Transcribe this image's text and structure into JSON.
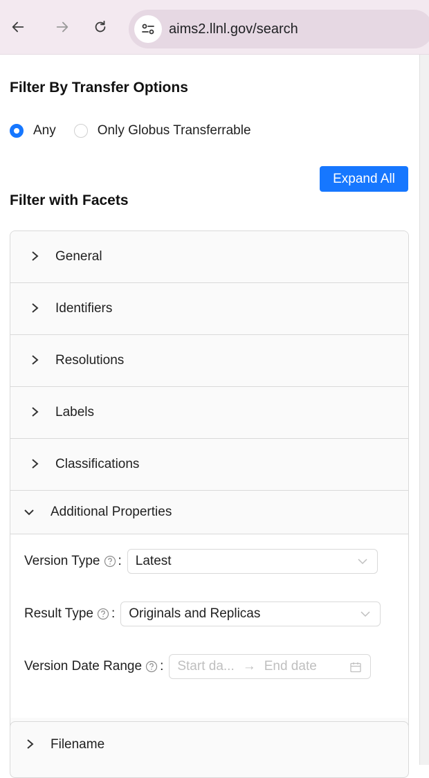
{
  "browser": {
    "url": "aims2.llnl.gov/search"
  },
  "transfer": {
    "title": "Filter By Transfer Options",
    "options": [
      {
        "label": "Any",
        "selected": true
      },
      {
        "label": "Only Globus Transferrable",
        "selected": false
      }
    ]
  },
  "facets": {
    "title": "Filter with Facets",
    "expand_label": "Expand All",
    "panels": [
      {
        "label": "General"
      },
      {
        "label": "Identifiers"
      },
      {
        "label": "Resolutions"
      },
      {
        "label": "Labels"
      },
      {
        "label": "Classifications"
      }
    ],
    "additional": {
      "label": "Additional Properties",
      "version_type": {
        "label": "Version Type",
        "value": "Latest"
      },
      "result_type": {
        "label": "Result Type",
        "value": "Originals and Replicas"
      },
      "date_range": {
        "label": "Version Date Range",
        "start_placeholder": "Start da...",
        "end_placeholder": "End date"
      }
    },
    "filename_label": "Filename"
  },
  "colors": {
    "primary": "#1677ff",
    "browser_bar": "#f3e9f0"
  }
}
